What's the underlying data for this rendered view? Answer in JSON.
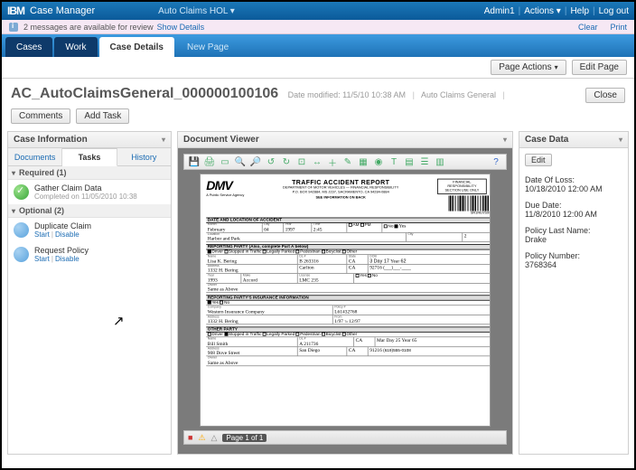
{
  "topbar": {
    "brand": "IBM",
    "app": "Case Manager",
    "context": "Auto Claims HOL ▾",
    "user": "Admin1",
    "actions": "Actions ▾",
    "help": "Help",
    "logout": "Log out"
  },
  "messages": {
    "text": "2 messages are available for review",
    "show": "Show Details",
    "clear": "Clear",
    "print": "Print"
  },
  "nav": {
    "tabs": [
      "Cases",
      "Work",
      "Case Details",
      "New Page"
    ],
    "active": 2
  },
  "actions_bar": {
    "page_actions": "Page Actions",
    "edit_page": "Edit Page"
  },
  "case": {
    "title": "AC_AutoClaimsGeneral_000000100106",
    "modified_label": "Date modified:",
    "modified_value": "11/5/10 10:38 AM",
    "type": "Auto Claims General",
    "comments_btn": "Comments",
    "addtask_btn": "Add Task",
    "close_btn": "Close"
  },
  "left": {
    "title": "Case Information",
    "tabs": [
      "Documents",
      "Tasks",
      "History"
    ],
    "active": 1,
    "required_label": "Required (1)",
    "optional_label": "Optional (2)",
    "tasks_required": [
      {
        "name": "Gather Claim Data",
        "meta": "Completed on 11/05/2010 10:38"
      }
    ],
    "tasks_optional": [
      {
        "name": "Duplicate Claim",
        "start": "Start",
        "disable": "Disable"
      },
      {
        "name": "Request Policy",
        "start": "Start",
        "disable": "Disable"
      }
    ]
  },
  "viewer": {
    "title": "Document Viewer",
    "page_label": "Page 1 of 1",
    "doc": {
      "agency": "DMV",
      "agency_sub": "A Public Service Agency",
      "title": "TRAFFIC ACCIDENT REPORT",
      "dept1": "DEPARTMENT OF MOTOR VEHICLES — FINANCIAL RESPONSIBILITY",
      "dept2": "P.O. BOX 942884, MS J237, SACRAMENTO, CA 94284-0884",
      "see_info": "SEE INFORMATION ON BACK",
      "fin_box": "FINANCIAL RESPONSIBILITY SECTION USE ONLY",
      "barcode_num": "SR1REVS99",
      "sec_date_loc": "DATE AND LOCATION OF ACCIDENT",
      "month": "February",
      "day": "04",
      "year": "1997",
      "time": "2:45",
      "ampm_pm": "PM",
      "location": "Harbor and Park",
      "city_acc": "",
      "injury_yes": "Yes",
      "sec_reporting": "REPORTING PARTY (Also, complete Part A below)",
      "rp_name": "Lisa K. Bering",
      "rp_dl": "B 263316",
      "rp_state": "CA",
      "rp_dob_m": "3",
      "rp_dob_d": "Day 17",
      "rp_dob_y": "62",
      "rp_addr": "1332 H. Bering",
      "rp_city2": "Carlton",
      "rp_st2": "CA",
      "rp_zip": "92716",
      "veh_year": "1993",
      "veh_make": "Accord",
      "veh_lic": "LMC 235",
      "owner_same": "Same as Above",
      "sec_insurance": "REPORTING PARTY'S INSURANCE INFORMATION",
      "ins_co": "Western Insurance Company",
      "policy": "L61432768",
      "ins_from": "1/97",
      "ins_to": "12/97",
      "ins_addr": "1332 H. Bering",
      "sec_other": "OTHER PARTY",
      "op_name": "Bill Smith",
      "op_dl": "A 211736",
      "op_st": "CA",
      "op_addr": "908 Dove Street",
      "op_city": "San Diego",
      "op_state2": "CA",
      "op_zip": "91216",
      "op_owner": "Same as Above"
    }
  },
  "right": {
    "title": "Case Data",
    "edit_btn": "Edit",
    "fields": [
      {
        "label": "Date Of Loss:",
        "value": "10/18/2010 12:00 AM"
      },
      {
        "label": "Due Date:",
        "value": "11/8/2010 12:00 AM"
      },
      {
        "label": "Policy Last Name:",
        "value": "Drake"
      },
      {
        "label": "Policy Number:",
        "value": "3768364"
      }
    ]
  }
}
